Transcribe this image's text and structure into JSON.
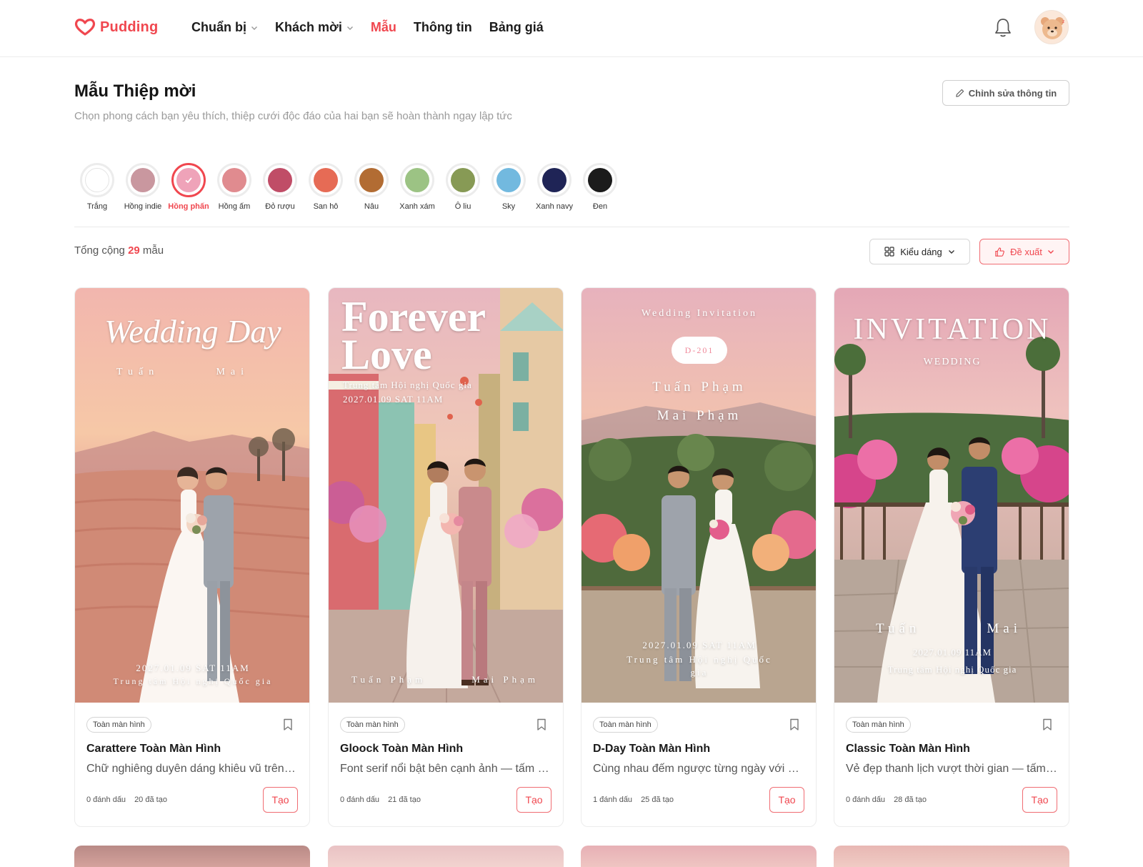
{
  "header": {
    "logo_text": "Pudding",
    "nav": [
      {
        "label": "Chuẩn bị",
        "has_dropdown": true
      },
      {
        "label": "Khách mời",
        "has_dropdown": true
      },
      {
        "label": "Mẫu",
        "active": true
      },
      {
        "label": "Thông tin"
      },
      {
        "label": "Bảng giá"
      }
    ]
  },
  "page": {
    "title": "Mẫu Thiệp mời",
    "subtitle": "Chọn phong cách bạn yêu thích, thiệp cưới độc đáo của hai bạn sẽ hoàn thành ngay lập tức",
    "edit_button": "Chỉnh sửa thông tin"
  },
  "colors": [
    {
      "label": "Trắng",
      "color": "#ffffff"
    },
    {
      "label": "Hồng indie",
      "color": "#c9979f"
    },
    {
      "label": "Hồng phấn",
      "color": "#efa3b9",
      "selected": true
    },
    {
      "label": "Hồng ấm",
      "color": "#e08b8f"
    },
    {
      "label": "Đỏ rượu",
      "color": "#c04d67"
    },
    {
      "label": "San hô",
      "color": "#e66b55"
    },
    {
      "label": "Nâu",
      "color": "#b26c33"
    },
    {
      "label": "Xanh xám",
      "color": "#9cc384"
    },
    {
      "label": "Ô liu",
      "color": "#879a55"
    },
    {
      "label": "Sky",
      "color": "#72b9df"
    },
    {
      "label": "Xanh navy",
      "color": "#1f2456"
    },
    {
      "label": "Đen",
      "color": "#1b1b1b"
    }
  ],
  "filter": {
    "total_prefix": "Tổng cộng",
    "total_count": "29",
    "total_suffix": "mẫu",
    "style_button": "Kiểu dáng",
    "sort_button": "Đề xuất"
  },
  "cards": [
    {
      "tag": "Toàn màn hình",
      "title": "Carattere Toàn Màn Hình",
      "desc": "Chữ nghiêng duyên dáng khiêu vũ trên ảnh cưới",
      "bookmarks": "0 đánh dấu",
      "created": "20 đã tạo",
      "create_label": "Tạo",
      "img": {
        "headline": "Wedding Day",
        "name_left": "Tuấn",
        "name_right": "Mai",
        "date": "2027.01.09 SAT 11AM",
        "venue": "Trung tâm Hội nghị Quốc gia"
      }
    },
    {
      "tag": "Toàn màn hình",
      "title": "Gloock Toàn Màn Hình",
      "desc": "Font serif nổi bật bên cạnh ảnh — tấm thiệp cá tính",
      "bookmarks": "0 đánh dấu",
      "created": "21 đã tạo",
      "create_label": "Tạo",
      "img": {
        "headline_1": "Forever",
        "headline_2": "Love",
        "venue": "Trung tâm Hội nghị Quốc gia",
        "date": "2027.01.09 SAT 11AM",
        "name_left": "Tuấn Phạm",
        "name_right": "Mai Phạm"
      }
    },
    {
      "tag": "Toàn màn hình",
      "title": "D-Day Toàn Màn Hình",
      "desc": "Cùng nhau đếm ngược từng ngày với bao háo hức",
      "bookmarks": "1 đánh dấu",
      "created": "25 đã tạo",
      "create_label": "Tạo",
      "img": {
        "top": "Wedding Invitation",
        "dday": "D-201",
        "name_1": "Tuấn Phạm",
        "name_2": "Mai Phạm",
        "date": "2027.01.09 SAT 11AM",
        "venue_1": "Trung tâm Hội nghị Quốc",
        "venue_2": "gia"
      }
    },
    {
      "tag": "Toàn màn hình",
      "title": "Classic Toàn Màn Hình",
      "desc": "Vẻ đẹp thanh lịch vượt thời gian — tấm thiệp cổ điển",
      "bookmarks": "0 đánh dấu",
      "created": "28 đã tạo",
      "create_label": "Tạo",
      "img": {
        "headline": "INVITATION",
        "sub": "WEDDING",
        "name_left": "Tuấn",
        "name_right": "Mai",
        "date": "2027.01.09 11AM",
        "venue": "Trung tâm Hội nghị Quốc gia"
      }
    }
  ],
  "theme": {
    "accent": "#f0474f"
  }
}
